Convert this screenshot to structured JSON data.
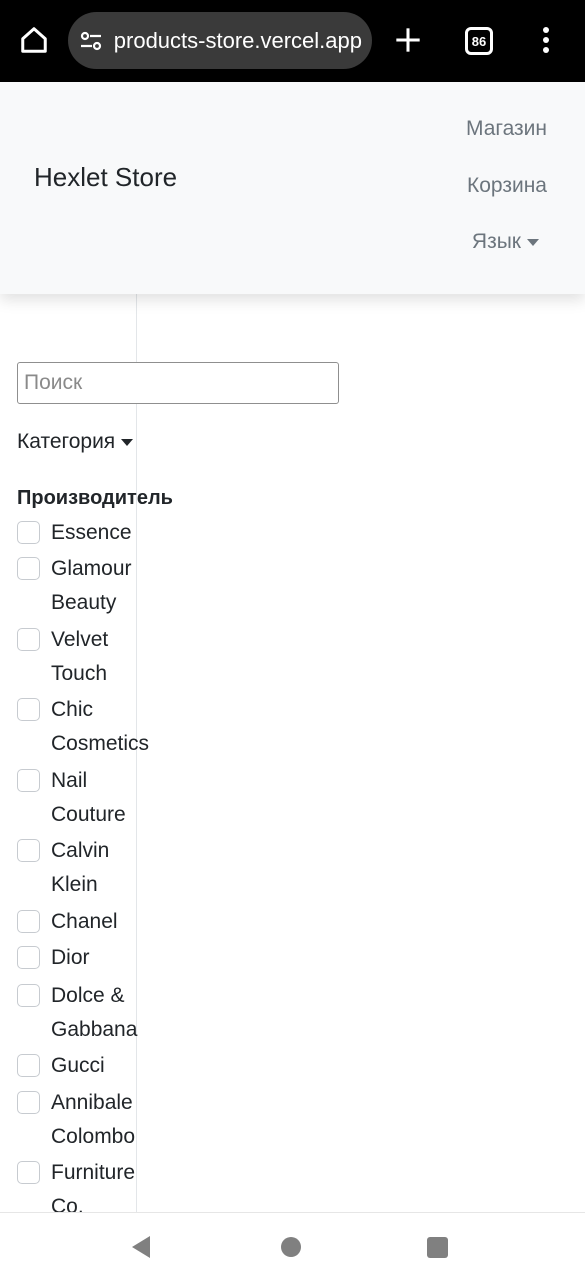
{
  "browser": {
    "url": "products-store.vercel.app",
    "tab_count": "86",
    "icons": {
      "home": "home-icon",
      "site_settings": "tune-icon",
      "new_tab": "plus-icon",
      "tabs": "tab-switcher-icon",
      "menu": "more-vert-icon"
    }
  },
  "navbar": {
    "brand": "Hexlet Store",
    "links": {
      "shop": "Магазин",
      "cart": "Корзина",
      "language": "Язык"
    }
  },
  "filters": {
    "search_placeholder": "Поиск",
    "category_label": "Категория",
    "manufacturer_title": "Производитель",
    "manufacturers": [
      {
        "line1": "Essence",
        "line2": ""
      },
      {
        "line1": "Glamour",
        "line2": "Beauty"
      },
      {
        "line1": "Velvet",
        "line2": "Touch"
      },
      {
        "line1": "Chic",
        "line2": "Cosmetics"
      },
      {
        "line1": "Nail",
        "line2": "Couture"
      },
      {
        "line1": "Calvin",
        "line2": "Klein"
      },
      {
        "line1": "Chanel",
        "line2": ""
      },
      {
        "line1": "Dior",
        "line2": ""
      },
      {
        "line1": "Dolce &",
        "line2": "Gabbana"
      },
      {
        "line1": "Gucci",
        "line2": ""
      },
      {
        "line1": "Annibale",
        "line2": "Colombo"
      },
      {
        "line1": "Furniture",
        "line2": "Co."
      }
    ]
  },
  "colors": {
    "chrome_bg": "#000000",
    "urlbar_bg": "#3a3a3a",
    "navbar_bg": "#f8f9fa",
    "nav_link": "#6c757d",
    "text": "#212529"
  }
}
